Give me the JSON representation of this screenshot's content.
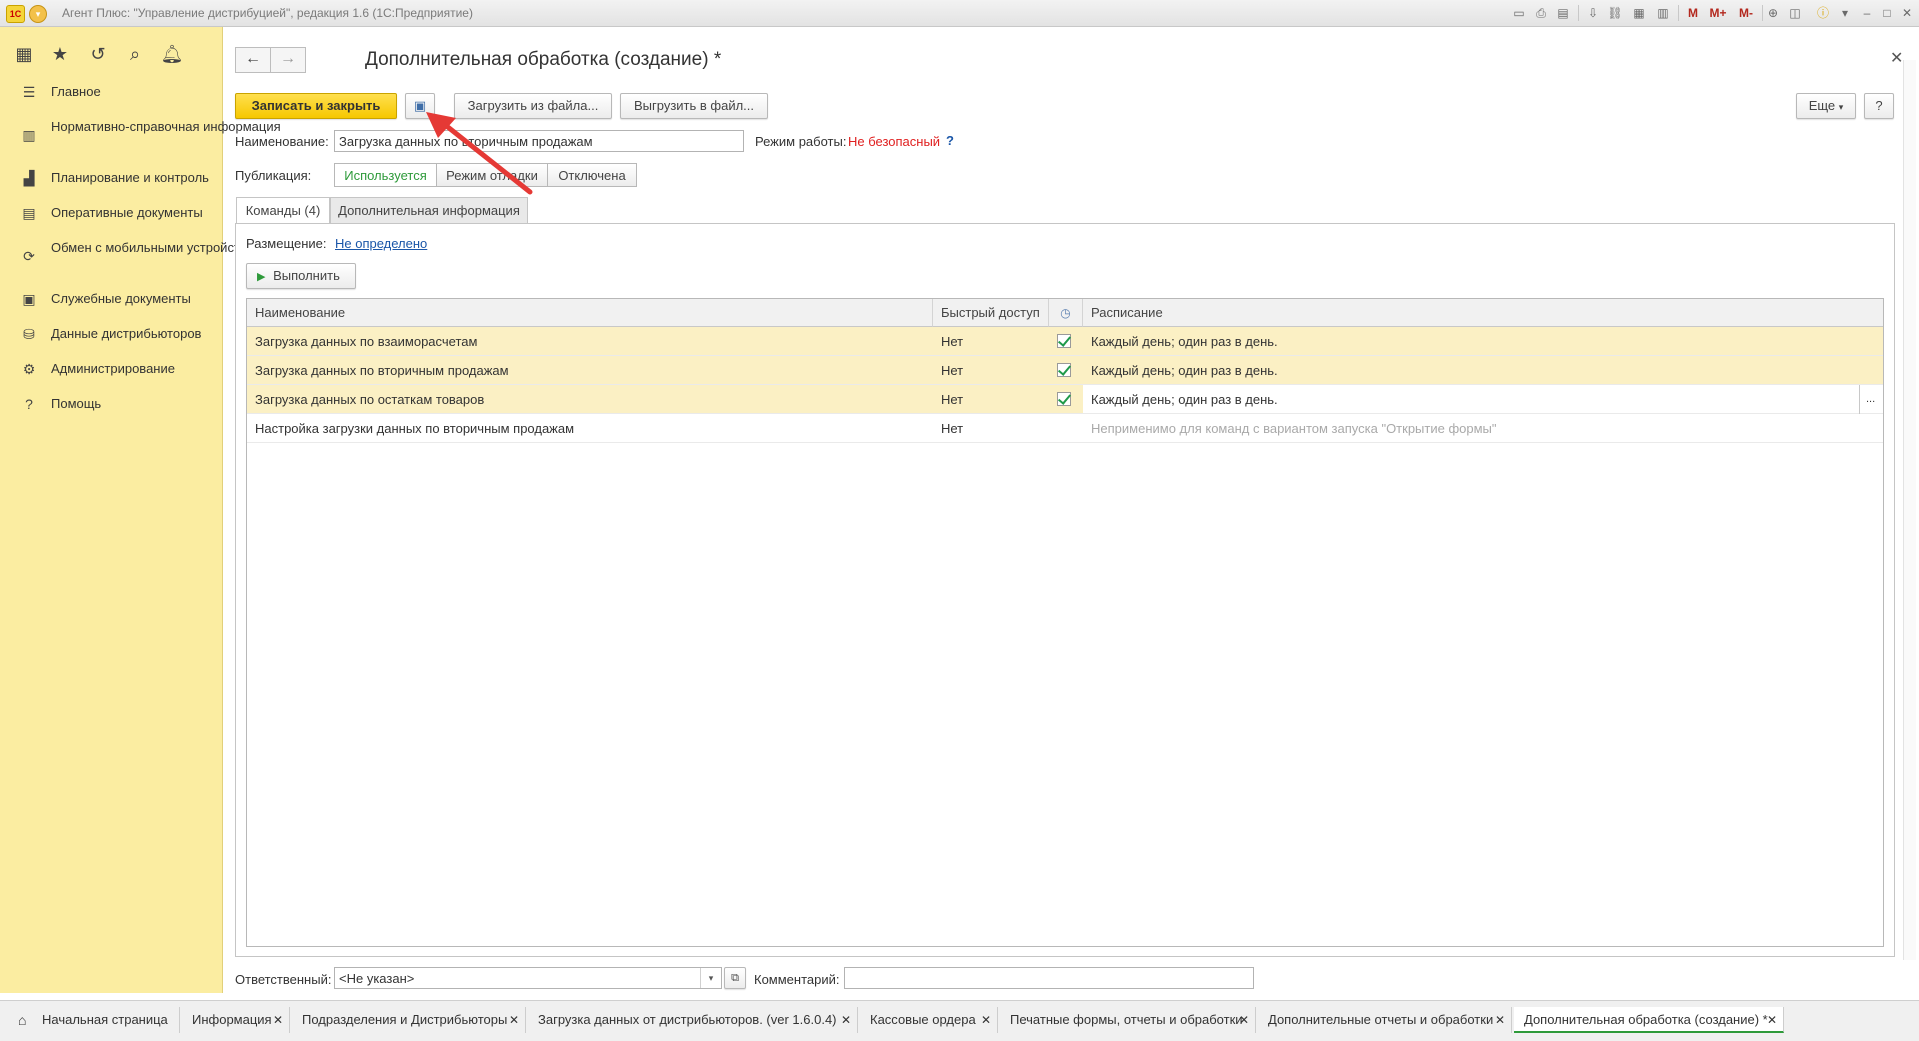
{
  "window": {
    "title": "Агент Плюс: \"Управление дистрибуцией\", редакция 1.6  (1С:Предприятие)",
    "logo_text": "1С",
    "toolbar_m": [
      "M",
      "M+",
      "M-"
    ]
  },
  "sidebar": {
    "items": [
      {
        "label": "Главное",
        "icon": "menu-icon"
      },
      {
        "label": "Нормативно-справочная информация",
        "icon": "catalog-icon"
      },
      {
        "label": "Планирование и контроль",
        "icon": "chart-icon"
      },
      {
        "label": "Оперативные документы",
        "icon": "documents-icon"
      },
      {
        "label": "Обмен с мобильными устройствами",
        "icon": "sync-icon"
      },
      {
        "label": "Служебные документы",
        "icon": "service-docs-icon"
      },
      {
        "label": "Данные дистрибьюторов",
        "icon": "distributor-data-icon"
      },
      {
        "label": "Администрирование",
        "icon": "gear-icon"
      },
      {
        "label": "Помощь",
        "icon": "help-icon"
      }
    ]
  },
  "form": {
    "title": "Дополнительная обработка (создание) *",
    "buttons": {
      "save_close": "Записать и закрыть",
      "load_file": "Загрузить из файла...",
      "export_file": "Выгрузить в файл...",
      "more": "Еще",
      "help": "?"
    },
    "name_label": "Наименование:",
    "name_value": "Загрузка данных по вторичным продажам",
    "mode_label": "Режим работы:",
    "mode_value": "Не безопасный",
    "mode_help": "?",
    "publication_label": "Публикация:",
    "publication_options": [
      "Используется",
      "Режим отладки",
      "Отключена"
    ],
    "tabs": [
      "Команды (4)",
      "Дополнительная информация"
    ],
    "placement_label": "Размещение:",
    "placement_value": "Не определено",
    "run_button": "Выполнить",
    "responsible_label": "Ответственный:",
    "responsible_value": "<Не указан>",
    "comment_label": "Комментарий:",
    "comment_value": ""
  },
  "grid": {
    "columns": [
      "Наименование",
      "Быстрый доступ",
      "Расписание"
    ],
    "rows": [
      {
        "name": "Загрузка данных по взаиморасчетам",
        "quick": "Нет",
        "checked": true,
        "schedule": "Каждый день; один раз в день.",
        "muted": false,
        "highlight": true
      },
      {
        "name": "Загрузка данных по вторичным продажам",
        "quick": "Нет",
        "checked": true,
        "schedule": "Каждый день; один раз в день.",
        "muted": false,
        "highlight": true
      },
      {
        "name": "Загрузка данных по остаткам товаров",
        "quick": "Нет",
        "checked": true,
        "schedule": "Каждый день; один раз в день.",
        "muted": false,
        "highlight": true
      },
      {
        "name": "Настройка загрузки данных по вторичным продажам",
        "quick": "Нет",
        "checked": false,
        "schedule": "Неприменимо для команд с вариантом запуска \"Открытие формы\"",
        "muted": true,
        "highlight": false
      }
    ],
    "ellipsis": "..."
  },
  "bottom_tabs": [
    {
      "label": "Начальная страница",
      "closable": false
    },
    {
      "label": "Информация",
      "closable": true
    },
    {
      "label": "Подразделения и Дистрибьюторы",
      "closable": true
    },
    {
      "label": "Загрузка данных от дистрибьюторов. (ver 1.6.0.4)",
      "closable": true
    },
    {
      "label": "Кассовые ордера",
      "closable": true
    },
    {
      "label": "Печатные формы, отчеты и обработки",
      "closable": true
    },
    {
      "label": "Дополнительные отчеты и обработки",
      "closable": true
    },
    {
      "label": "Дополнительная обработка (создание) *",
      "closable": true
    }
  ],
  "colors": {
    "sidebar_bg": "#fbeda1",
    "primary_button": "#f6c800",
    "warning_text": "#e02020",
    "active_green": "#2e9a3a",
    "row_highlight": "#fbf0c4",
    "arrow": "#e53935"
  }
}
